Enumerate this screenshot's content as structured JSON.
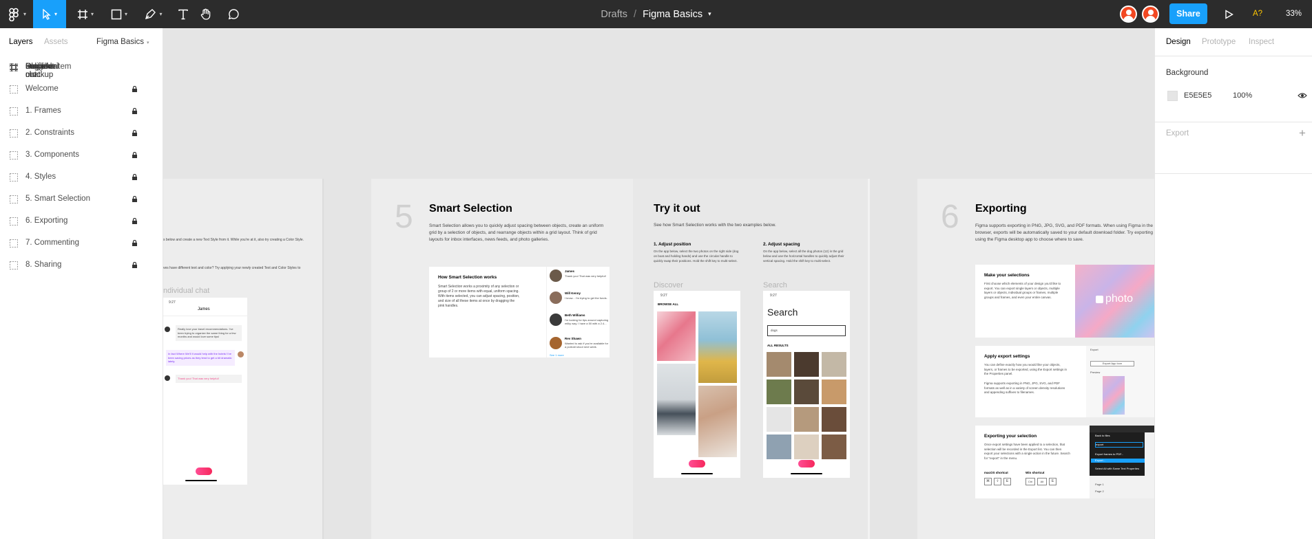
{
  "toolbar": {
    "breadcrumb": {
      "drafts": "Drafts",
      "separator": "/",
      "file": "Figma Basics"
    },
    "share_label": "Share",
    "accessibility": "A?",
    "zoom": "33%",
    "tools": [
      "figma-menu",
      "move",
      "frame",
      "shape",
      "pen",
      "text",
      "hand",
      "comment"
    ]
  },
  "left_panel": {
    "tabs": {
      "layers": "Layers",
      "assets": "Assets"
    },
    "page": "Figma Basics",
    "frames": [
      "Profile",
      "Register",
      "Chats mockup",
      "Chats",
      "Individual chat",
      "Discover",
      "Search",
      "Logged out",
      "Discover"
    ],
    "items": [
      {
        "label": "Chat list item",
        "locked": false
      },
      {
        "label": "Welcome",
        "locked": true
      },
      {
        "label": "1. Frames",
        "locked": true
      },
      {
        "label": "2. Constraints",
        "locked": true
      },
      {
        "label": "3. Components",
        "locked": true
      },
      {
        "label": "4. Styles",
        "locked": true
      },
      {
        "label": "5. Smart Selection",
        "locked": true
      },
      {
        "label": "6. Exporting",
        "locked": true
      },
      {
        "label": "7. Commenting",
        "locked": true
      },
      {
        "label": "8. Sharing",
        "locked": true
      }
    ]
  },
  "right_panel": {
    "tabs": {
      "design": "Design",
      "prototype": "Prototype",
      "inspect": "Inspect"
    },
    "background": {
      "title": "Background",
      "hex": "E5E5E5",
      "opacity": "100%",
      "color": "#e5e5e5"
    },
    "export_title": "Export"
  },
  "canvas": {
    "left_frame": {
      "text1": "s below and create a new Text Style from it. While you're at it, also try creating a Color Style.",
      "text2": "ves have different text and color? Try applying your newly created Text and Color Styles to",
      "label": "ndividual chat",
      "phone": {
        "time": "9:27",
        "header": "James",
        "msg1": "Really love your travel recommendations. I've been trying to organize the same thing for a few months and would love some tips!",
        "msg2": "In fact Where We'll It would help with the hotels! I've been saving prices as they tend to get a bit dramatic lately.",
        "msg3": "Thank you! That was very helpful!"
      }
    },
    "smart_selection": {
      "number": "5",
      "title": "Smart Selection",
      "body": "Smart Selection allows you to quickly adjust spacing between objects, create an uniform grid by a selection of objects, and rearrange objects within a grid layout. Think of grid layouts for inbox interfaces, news feeds, and photo galleries.",
      "card_title": "How Smart Selection works",
      "card_body": "Smart Selection works a proximity of any selection or group of 2 or more items with equal, uniform spacing. With items selected, you can adjust spacing, position, and size of all these items at once by dragging the pink handles.",
      "chats": [
        {
          "name": "James",
          "text": "Thank you! That was very helpful!"
        },
        {
          "name": "Will Kenny",
          "text": "I know... I'm trying to get the funds."
        },
        {
          "name": "Beth Williams",
          "text": "I'm looking for tips around capturing milky way. I have a 50 with a 2.4..."
        },
        {
          "name": "Rev Shawn",
          "text": "Wanted to ask if you're available for a portrait shoot next week."
        }
      ],
      "see_more": "See 1 more"
    },
    "try_it": {
      "title": "Try it out",
      "intro": "See how Smart Selection works with the two examples below.",
      "adjust_position_title": "1. Adjust position",
      "adjust_position_body": "On the app below, select the two photos on the right side (dog on boat and holding hands) and use the circular handle to quickly swap their positions. Hold the shift key to multi-select.",
      "adjust_spacing_title": "2. Adjust spacing",
      "adjust_spacing_body": "On the app below, select all the dog photos (12) in the grid below and use the horizontal handles to quickly adjust their vertical spacing. Hold the shift key to multi-select.",
      "discover_label": "Discover",
      "search_label": "Search",
      "discover_phone": {
        "time": "9:27",
        "heading": "BROWSE ALL"
      },
      "search_phone": {
        "time": "9:27",
        "title": "Search",
        "query": "dogs",
        "results": "ALL RESULTS"
      }
    },
    "exporting": {
      "number": "6",
      "title": "Exporting",
      "body": "Figma supports exporting in PNG, JPG, SVG, and PDF formats. When using Figma in the browser, exports will be automatically saved to your default download folder. Try exporting using the Figma desktop app to choose where to save.",
      "card1_title": "Make your selections",
      "card1_body": "First choose which elements of your design you'd like to export. You can export single layers or objects, multiple layers or objects, individual groups or frames, multiple groups and frames, and even your entire canvas.",
      "photo_word": "photo",
      "card2_title": "Apply export settings",
      "card2_body1": "You can define exactly how you would like your objects, layers, or frames to be exported, using the Export settings in the Properties panel.",
      "card2_body2": "Figma supports exporting in PNG, JPG, SVG, and PDF formats as well as in a variety of screen density resolutions and appending suffixes to filenames.",
      "export_panel": {
        "title": "Export",
        "button": "Export App Icon",
        "preview": "Preview"
      },
      "card3_title": "Exporting your selection",
      "card3_body": "Once export settings have been applied to a selection, that selection will be recorded in the Export list. You can then export your selections with a single action in the future. Search for \"export\" in the menu.",
      "mac_shortcut_title": "macOS shortcut",
      "mac_keys": [
        "⌘",
        "⇧",
        "E"
      ],
      "win_shortcut_title": "Win shortcut",
      "win_keys": [
        "Ctrl",
        "Alt",
        "E"
      ],
      "menu": {
        "back": "Back to files",
        "search": "export",
        "item1": "Export frames to PDF...",
        "item2": "Export...",
        "item3": "Select All with Same Text Properties",
        "page1": "Page 1",
        "page2": "Page 2"
      }
    }
  }
}
